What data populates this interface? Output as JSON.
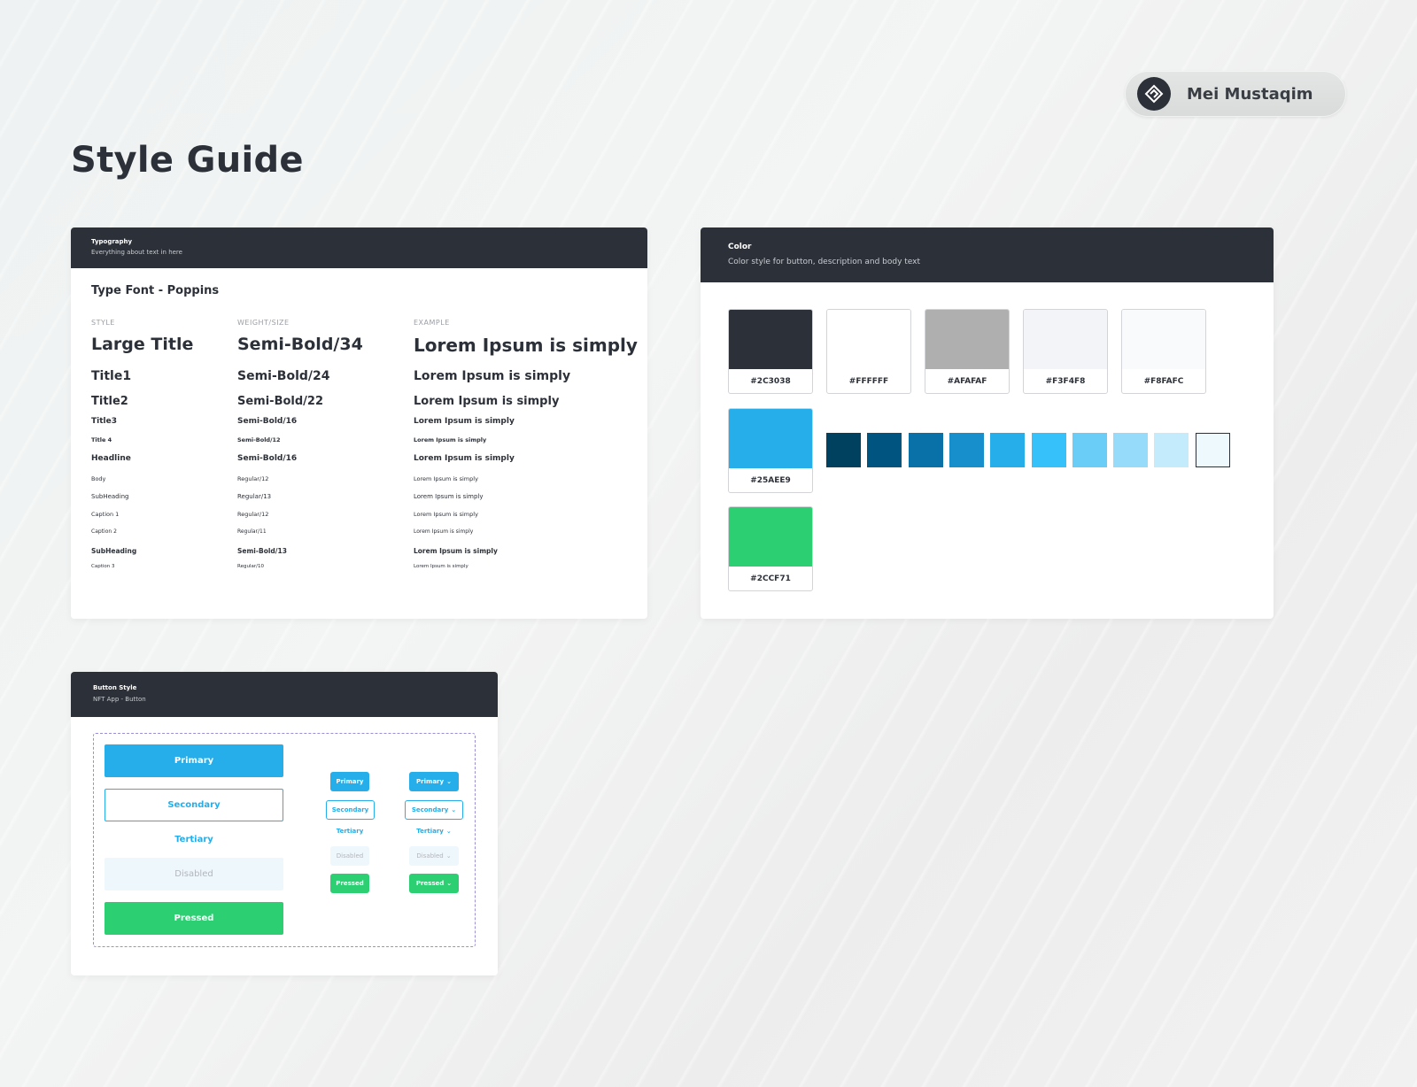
{
  "author": {
    "name": "Mei Mustaqim"
  },
  "page": {
    "title": "Style Guide"
  },
  "typography": {
    "title": "Typography",
    "subtitle": "Everything about text in here",
    "font_label": "Type Font - Poppins",
    "columns": [
      "STYLE",
      "WEIGHT/SIZE",
      "EXAMPLE"
    ],
    "rows": [
      {
        "style": "Large Title",
        "weight": "Semi-Bold/34",
        "example": "Lorem Ipsum is simply"
      },
      {
        "style": "Title1",
        "weight": "Semi-Bold/24",
        "example": "Lorem Ipsum is simply"
      },
      {
        "style": "Title2",
        "weight": "Semi-Bold/22",
        "example": "Lorem Ipsum is simply"
      },
      {
        "style": "Title3",
        "weight": "Semi-Bold/16",
        "example": "Lorem Ipsum is simply"
      },
      {
        "style": "Title 4",
        "weight": "Semi-Bold/12",
        "example": "Lorem Ipsum is simply"
      },
      {
        "style": "Headline",
        "weight": "Semi-Bold/16",
        "example": "Lorem Ipsum is simply"
      },
      {
        "style": "Body",
        "weight": "Regular/12",
        "example": "Lorem Ipsum is simply"
      },
      {
        "style": "SubHeading",
        "weight": "Regular/13",
        "example": "Lorem Ipsum is simply"
      },
      {
        "style": "Caption 1",
        "weight": "Regular/12",
        "example": "Lorem Ipsum is simply"
      },
      {
        "style": "Caption 2",
        "weight": "Regular/11",
        "example": "Lorem Ipsum is simply"
      },
      {
        "style": "SubHeading",
        "weight": "Semi-Bold/13",
        "example": "Lorem Ipsum is simply"
      },
      {
        "style": "Caption 3",
        "weight": "Regular/10",
        "example": "Lorem Ipsum is simply"
      }
    ]
  },
  "color": {
    "title": "Color",
    "subtitle": "Color style for button, description and body text",
    "swatches": [
      {
        "hex": "#2C3038",
        "label": "#2C3038"
      },
      {
        "hex": "#FFFFFF",
        "label": "#FFFFFF"
      },
      {
        "hex": "#AFAFAF",
        "label": "#AFAFAF"
      },
      {
        "hex": "#F3F4F8",
        "label": "#F3F4F8"
      },
      {
        "hex": "#F8FAFC",
        "label": "#F8FAFC"
      },
      {
        "hex": "#25AEE9",
        "label": "#25AEE9"
      },
      {
        "hex": "#2CCF71",
        "label": "#2CCF71"
      }
    ],
    "shades": [
      "#00415F",
      "#005580",
      "#0A70A8",
      "#168FCC",
      "#25AEE9",
      "#37C1FA",
      "#69CDF8",
      "#96DBFA",
      "#C3EBFC",
      "#EEF9FE"
    ]
  },
  "buttons": {
    "title": "Button Style",
    "subtitle": "NFT App - Button",
    "primary": "Primary",
    "secondary": "Secondary",
    "tertiary": "Tertiary",
    "disabled": "Disabled",
    "pressed": "Pressed"
  }
}
